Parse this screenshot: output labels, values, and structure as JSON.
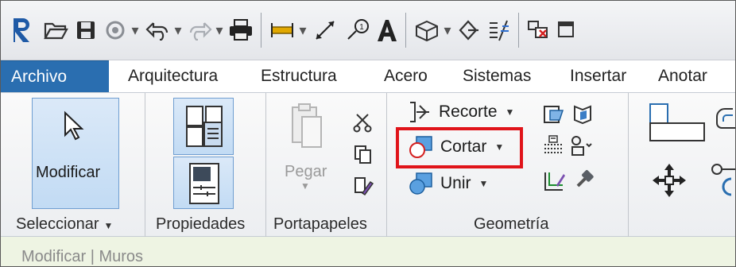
{
  "quick_access": {
    "icons": [
      "revit-logo-icon",
      "open-folder-icon",
      "save-icon",
      "sync-icon",
      "undo-icon",
      "redo-icon",
      "print-icon",
      "measure-icon",
      "aligned-dimension-icon",
      "tag-icon",
      "text-icon",
      "3d-view-icon",
      "section-icon",
      "thin-lines-icon",
      "close-hidden-icon",
      "switch-windows-icon"
    ],
    "colors": {
      "revit_blue": "#1f5aa6",
      "accent": "#2a6eb0"
    }
  },
  "tabs": [
    {
      "label": "Archivo",
      "active": true
    },
    {
      "label": "Arquitectura"
    },
    {
      "label": "Estructura"
    },
    {
      "label": "Acero"
    },
    {
      "label": "Sistemas"
    },
    {
      "label": "Insertar"
    },
    {
      "label": "Anotar"
    }
  ],
  "panels": {
    "seleccionar": {
      "title": "Seleccionar",
      "modify_label": "Modificar"
    },
    "propiedades": {
      "title": "Propiedades"
    },
    "portapapeles": {
      "title": "Portapapeles",
      "paste_label": "Pegar"
    },
    "geometria": {
      "title": "Geometría",
      "recorte_label": "Recorte",
      "cortar_label": "Cortar",
      "unir_label": "Unir"
    }
  },
  "highlight": {
    "color": "#e0141a",
    "target": "Cortar"
  },
  "context_bar": {
    "label": "Modificar | Muros"
  }
}
